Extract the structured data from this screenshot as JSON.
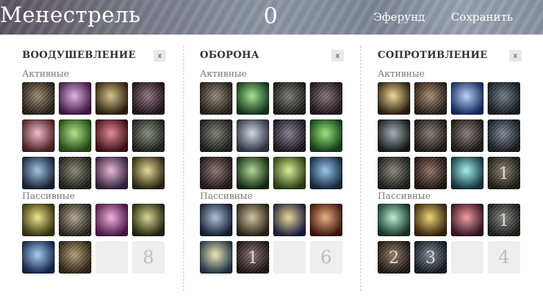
{
  "header": {
    "title": "Менестрель",
    "points": "0",
    "link_left": "Эферунд",
    "link_right": "Сохранить"
  },
  "panels": [
    {
      "title": "ВООДУШЕВЛЕНИЕ",
      "close": "x",
      "active_label": "Активные",
      "passive_label": "Пассивные",
      "active": [
        {
          "name": "skill-icon",
          "c1": "#8a6d4d",
          "c2": "#2e2418",
          "dim": true,
          "num": ""
        },
        {
          "name": "skill-icon",
          "c1": "#d7a2df",
          "c2": "#5b1e60",
          "dim": false,
          "num": ""
        },
        {
          "name": "skill-icon",
          "c1": "#d1b46a",
          "c2": "#3c2b14",
          "dim": false,
          "num": ""
        },
        {
          "name": "skill-icon",
          "c1": "#7b4c63",
          "c2": "#201218",
          "dim": true,
          "num": ""
        },
        {
          "name": "skill-icon",
          "c1": "#f3a9c5",
          "c2": "#6a2b2e",
          "dim": false,
          "num": ""
        },
        {
          "name": "skill-icon",
          "c1": "#9ee06a",
          "c2": "#2f6b1a",
          "dim": false,
          "num": ""
        },
        {
          "name": "skill-icon",
          "c1": "#e06a7a",
          "c2": "#5a1420",
          "dim": false,
          "num": ""
        },
        {
          "name": "skill-icon",
          "c1": "#6b7060",
          "c2": "#22241e",
          "dim": true,
          "num": ""
        },
        {
          "name": "skill-icon",
          "c1": "#8bb3e0",
          "c2": "#1d2f4c",
          "dim": false,
          "num": ""
        },
        {
          "name": "skill-icon",
          "c1": "#6d6a52",
          "c2": "#24231a",
          "dim": true,
          "num": ""
        },
        {
          "name": "skill-icon",
          "c1": "#e9a6c6",
          "c2": "#46305a",
          "dim": false,
          "num": ""
        },
        {
          "name": "skill-icon",
          "c1": "#e4d27a",
          "c2": "#3a3416",
          "dim": false,
          "num": ""
        }
      ],
      "passive": [
        {
          "name": "skill-icon",
          "c1": "#f0e06a",
          "c2": "#4a4a12",
          "dim": false,
          "num": ""
        },
        {
          "name": "skill-icon",
          "c1": "#a99a78",
          "c2": "#2d2820",
          "dim": true,
          "num": ""
        },
        {
          "name": "skill-icon",
          "c1": "#f29ed6",
          "c2": "#6b1f66",
          "dim": false,
          "num": ""
        },
        {
          "name": "skill-icon",
          "c1": "#cfd06e",
          "c2": "#2f3212",
          "dim": false,
          "num": ""
        },
        {
          "name": "skill-icon",
          "c1": "#8ec6f0",
          "c2": "#1a2f6b",
          "dim": false,
          "num": ""
        },
        {
          "name": "skill-icon",
          "c1": "#a88852",
          "c2": "#3a2a14",
          "dim": true,
          "num": ""
        },
        {
          "name": "empty-slot",
          "c1": "",
          "c2": "",
          "dim": false,
          "num": ""
        },
        {
          "name": "empty-slot",
          "c1": "",
          "c2": "",
          "dim": false,
          "num": "8"
        }
      ]
    },
    {
      "title": "ОБОРОНА",
      "close": "x",
      "active_label": "Активные",
      "passive_label": "Пассивные",
      "active": [
        {
          "name": "skill-icon",
          "c1": "#7a6a52",
          "c2": "#2a241a",
          "dim": true,
          "num": ""
        },
        {
          "name": "skill-icon",
          "c1": "#8ae06a",
          "c2": "#1a4a2a",
          "dim": false,
          "num": ""
        },
        {
          "name": "skill-icon",
          "c1": "#5a5a50",
          "c2": "#1e1e1a",
          "dim": true,
          "num": ""
        },
        {
          "name": "skill-icon",
          "c1": "#6a4a55",
          "c2": "#20161a",
          "dim": true,
          "num": ""
        },
        {
          "name": "skill-icon",
          "c1": "#5f5f54",
          "c2": "#1f1f1a",
          "dim": true,
          "num": ""
        },
        {
          "name": "skill-icon",
          "c1": "#c9d0d8",
          "c2": "#3e4a63",
          "dim": false,
          "num": ""
        },
        {
          "name": "skill-icon",
          "c1": "#6a5a70",
          "c2": "#1e1a22",
          "dim": true,
          "num": ""
        },
        {
          "name": "skill-icon",
          "c1": "#7ee05a",
          "c2": "#1a5a20",
          "dim": false,
          "num": ""
        },
        {
          "name": "skill-icon",
          "c1": "#6f4e4a",
          "c2": "#241816",
          "dim": true,
          "num": ""
        },
        {
          "name": "skill-icon",
          "c1": "#9ad07a",
          "c2": "#1a3a14",
          "dim": false,
          "num": ""
        },
        {
          "name": "skill-icon",
          "c1": "#d8f07a",
          "c2": "#3c5a1a",
          "dim": false,
          "num": ""
        },
        {
          "name": "skill-icon",
          "c1": "#7ab8e8",
          "c2": "#1a3a5a",
          "dim": false,
          "num": ""
        }
      ],
      "passive": [
        {
          "name": "skill-icon",
          "c1": "#9ab0d0",
          "c2": "#1a2a4a",
          "dim": false,
          "num": ""
        },
        {
          "name": "skill-icon",
          "c1": "#c8b888",
          "c2": "#3a3020",
          "dim": false,
          "num": ""
        },
        {
          "name": "skill-icon",
          "c1": "#e8d07a",
          "c2": "#2a2a5a",
          "dim": false,
          "num": ""
        },
        {
          "name": "skill-icon",
          "c1": "#e89a5a",
          "c2": "#5a1a14",
          "dim": false,
          "num": ""
        },
        {
          "name": "skill-icon",
          "c1": "#f0e6a0",
          "c2": "#2a4a6a",
          "dim": false,
          "num": ""
        },
        {
          "name": "skill-icon",
          "c1": "#6a4a4a",
          "c2": "#221616",
          "dim": true,
          "num": "1"
        },
        {
          "name": "empty-slot",
          "c1": "",
          "c2": "",
          "dim": false,
          "num": ""
        },
        {
          "name": "empty-slot",
          "c1": "",
          "c2": "",
          "dim": false,
          "num": "6"
        }
      ]
    },
    {
      "title": "СОПРОТИВЛЕНИЕ",
      "close": "x",
      "active_label": "Активные",
      "passive_label": "Пассивные",
      "active": [
        {
          "name": "skill-icon",
          "c1": "#f0d07a",
          "c2": "#3a2a12",
          "dim": false,
          "num": ""
        },
        {
          "name": "skill-icon",
          "c1": "#9a7050",
          "c2": "#2e2018",
          "dim": true,
          "num": ""
        },
        {
          "name": "skill-icon",
          "c1": "#a8c8f8",
          "c2": "#1a3a8a",
          "dim": false,
          "num": ""
        },
        {
          "name": "skill-icon",
          "c1": "#4a5a6a",
          "c2": "#161c22",
          "dim": true,
          "num": ""
        },
        {
          "name": "skill-icon",
          "c1": "#8a9aa0",
          "c2": "#1e2426",
          "dim": false,
          "num": ""
        },
        {
          "name": "skill-icon",
          "c1": "#6a5a4a",
          "c2": "#201a16",
          "dim": true,
          "num": ""
        },
        {
          "name": "skill-icon",
          "c1": "#6a5a5a",
          "c2": "#1e1818",
          "dim": true,
          "num": ""
        },
        {
          "name": "skill-icon",
          "c1": "#5a6a7a",
          "c2": "#161c24",
          "dim": true,
          "num": ""
        },
        {
          "name": "skill-icon",
          "c1": "#6a6a5a",
          "c2": "#20201a",
          "dim": true,
          "num": ""
        },
        {
          "name": "skill-icon",
          "c1": "#7a4a3a",
          "c2": "#221410",
          "dim": true,
          "num": ""
        },
        {
          "name": "skill-icon",
          "c1": "#8af0f0",
          "c2": "#1a4a5a",
          "dim": false,
          "num": ""
        },
        {
          "name": "skill-icon",
          "c1": "#6a604a",
          "c2": "#201e16",
          "dim": true,
          "num": "1"
        }
      ],
      "passive": [
        {
          "name": "skill-icon",
          "c1": "#a8f0c8",
          "c2": "#1a4a3a",
          "dim": false,
          "num": ""
        },
        {
          "name": "skill-icon",
          "c1": "#f0c84a",
          "c2": "#4a3212",
          "dim": false,
          "num": ""
        },
        {
          "name": "skill-icon",
          "c1": "#f08080",
          "c2": "#4a1a3a",
          "dim": false,
          "num": ""
        },
        {
          "name": "skill-icon",
          "c1": "#6a6a60",
          "c2": "#20201c",
          "dim": true,
          "num": "1"
        },
        {
          "name": "skill-icon",
          "c1": "#7a5a3a",
          "c2": "#221812",
          "dim": true,
          "num": "2"
        },
        {
          "name": "skill-icon",
          "c1": "#5a6a7a",
          "c2": "#161c22",
          "dim": true,
          "num": "3"
        },
        {
          "name": "empty-slot",
          "c1": "",
          "c2": "",
          "dim": false,
          "num": ""
        },
        {
          "name": "empty-slot",
          "c1": "",
          "c2": "",
          "dim": false,
          "num": "4"
        }
      ]
    }
  ]
}
